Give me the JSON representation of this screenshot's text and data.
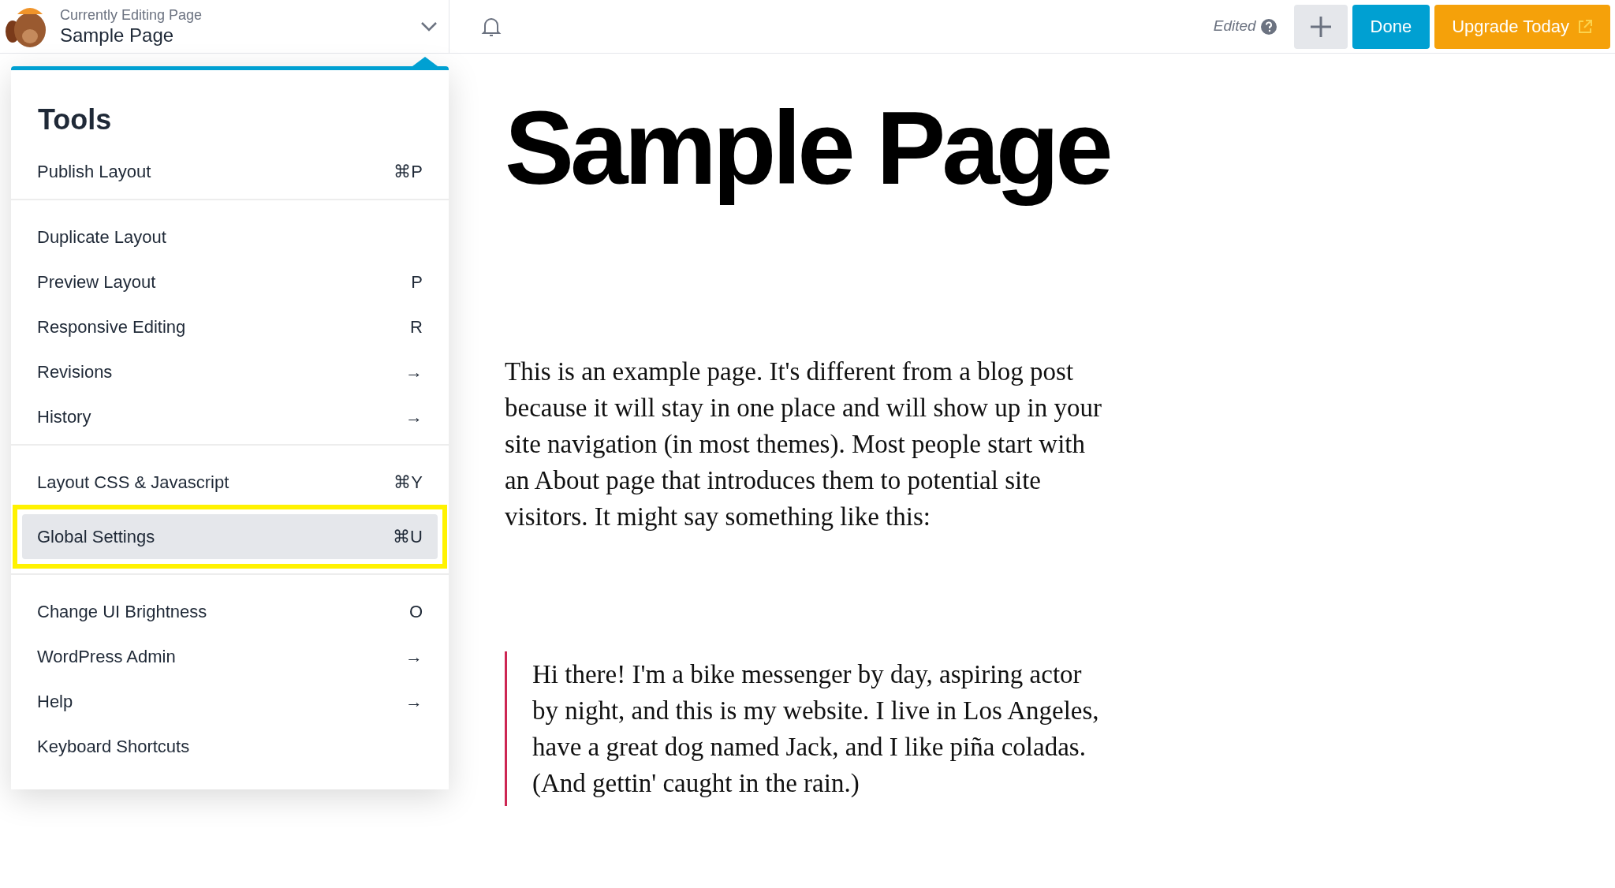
{
  "header": {
    "subtitle": "Currently Editing Page",
    "title": "Sample Page",
    "status": "Edited",
    "done": "Done",
    "upgrade": "Upgrade Today"
  },
  "menu": {
    "title": "Tools",
    "groups": [
      [
        {
          "label": "Publish Layout",
          "shortcut": "⌘P",
          "selected": false
        }
      ],
      [
        {
          "label": "Duplicate Layout",
          "selected": false
        },
        {
          "label": "Preview Layout",
          "shortcut": "P",
          "selected": false
        },
        {
          "label": "Responsive Editing",
          "shortcut": "R",
          "selected": false
        },
        {
          "label": "Revisions",
          "shortcut": "→",
          "selected": false
        },
        {
          "label": "History",
          "shortcut": "→",
          "selected": false
        }
      ],
      [
        {
          "label": "Layout CSS & Javascript",
          "shortcut": "⌘Y",
          "selected": false
        },
        {
          "label": "Global Settings",
          "shortcut": "⌘U",
          "selected": true
        }
      ],
      [
        {
          "label": "Change UI Brightness",
          "shortcut": "O",
          "selected": false
        },
        {
          "label": "WordPress Admin",
          "shortcut": "→",
          "selected": false
        },
        {
          "label": "Help",
          "shortcut": "→",
          "selected": false
        },
        {
          "label": "Keyboard Shortcuts",
          "selected": false
        }
      ]
    ]
  },
  "page": {
    "heading": "Sample Page",
    "paragraph": "This is an example page. It's different from a blog post because it will stay in one place and will show up in your site navigation (in most themes). Most people start with an About page that introduces them to potential site visitors. It might say something like this:",
    "quote": "Hi there! I'm a bike messenger by day, aspiring actor by night, and this is my website. I live in Los Angeles, have a great dog named Jack, and I like piña coladas. (And gettin' caught in the rain.)"
  }
}
